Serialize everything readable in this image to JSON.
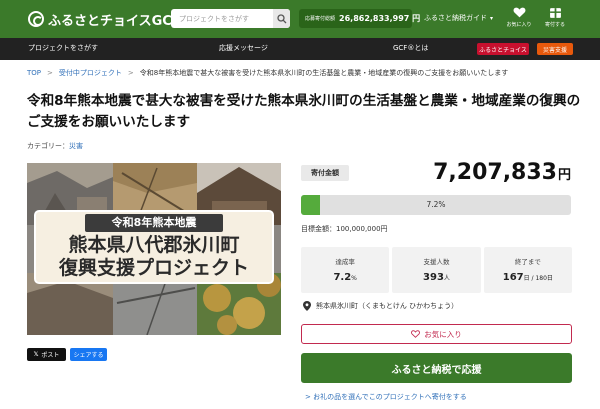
{
  "header": {
    "logo_text": "ふるさとチョイスGCF",
    "search": {
      "placeholder": "プロジェクトをさがす"
    },
    "donation_total": {
      "label": "応募寄付総額",
      "value": "26,862,833,997 円"
    },
    "guide_label": "ふるさと納税ガイド",
    "favorites_label": "お気に入り",
    "donation_history_label": "寄付する",
    "colors": {
      "brand": "#3b7a2a",
      "brand_dark": "#2a6419"
    }
  },
  "nav": {
    "find_projects": "プロジェクトをさがす",
    "messages": "応援メッセージ",
    "about": "GCF®とは",
    "furusato_choice": "ふるさとチョイス",
    "disaster_support": "災害支援",
    "colors": {
      "furusato_choice": "#c8102e",
      "disaster_support": "#e8590c"
    }
  },
  "breadcrumb": {
    "top": "TOP",
    "accepting": "受付中プロジェクト",
    "current": "令和8年熊本地震で甚大な被害を受けた熊本県氷川町の生活基盤と農業・地域産業の復興のご支援をお願いいたします"
  },
  "project": {
    "title": "令和8年熊本地震で甚大な被害を受けた熊本県氷川町の生活基盤と農業・地域産業の復興のご支援をお願いいたします",
    "category_label": "カテゴリー：",
    "category_value": "災害",
    "hero": {
      "banner_small": "令和8年熊本地震",
      "banner_line1": "熊本県八代郡氷川町",
      "banner_line2": "復興支援プロジェクト"
    }
  },
  "share": {
    "post_label": "ポスト",
    "share_label": "シェアする"
  },
  "funding": {
    "amount_label": "寄付金額",
    "amount_value": "7,207,833",
    "amount_unit": "円",
    "progress_text": "7.2%",
    "progress_fraction": 0.072,
    "target_label": "目標金額：",
    "target_value": "100,000,000円"
  },
  "stats": {
    "rate": {
      "label": "達成率",
      "value": "7.2",
      "unit": "%"
    },
    "supporters": {
      "label": "支援人数",
      "value": "393",
      "unit": "人"
    },
    "ending": {
      "label": "終了まで",
      "value": "167",
      "unit": "日 / 180日"
    }
  },
  "location": "熊本県氷川町（くまもとけん ひかわちょう）",
  "actions": {
    "favorite": "お気に入り",
    "donate": "ふるさと納税で応援",
    "gift_link": "> お礼の品を選んでこのプロジェクトへ寄付をする"
  }
}
